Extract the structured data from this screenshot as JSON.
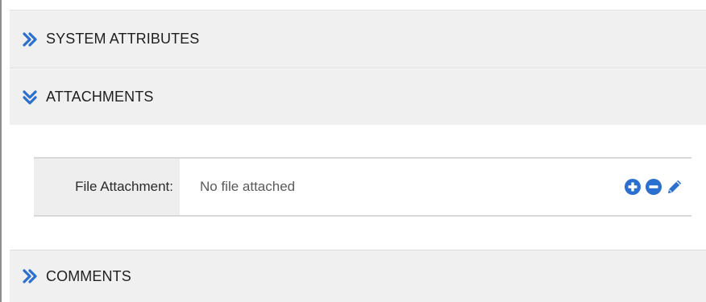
{
  "sections": {
    "system_attributes": {
      "title": "SYSTEM ATTRIBUTES",
      "expanded": false,
      "icon": "chevron-double-right-icon"
    },
    "attachments": {
      "title": "ATTACHMENTS",
      "expanded": true,
      "icon": "chevron-double-down-icon"
    },
    "comments": {
      "title": "COMMENTS",
      "expanded": false,
      "icon": "chevron-double-right-icon"
    }
  },
  "file_attachment": {
    "label": "File Attachment:",
    "value": "No file attached",
    "actions": [
      "add-icon",
      "remove-icon",
      "edit-icon"
    ]
  },
  "colors": {
    "accent": "#2b6fcf",
    "header_bg": "#f0f0f0",
    "label_bg": "#eeeeee"
  }
}
